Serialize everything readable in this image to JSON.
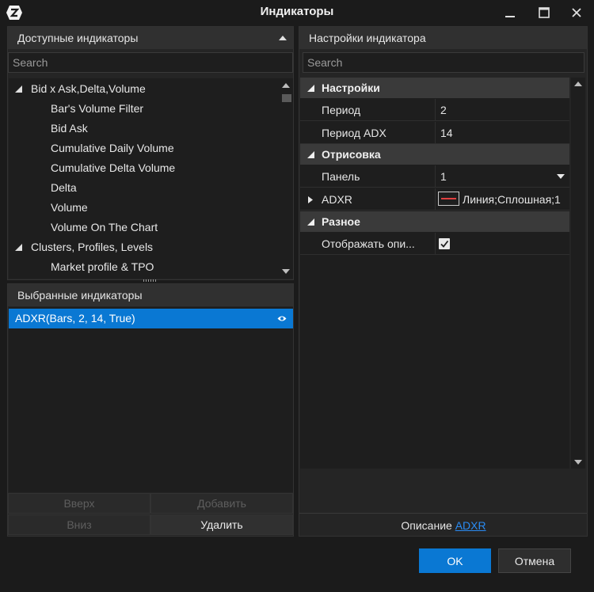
{
  "window": {
    "title": "Индикаторы",
    "icons": {
      "logo": "app-logo-icon",
      "minimize": "minimize-icon",
      "maximize": "maximize-icon",
      "close": "close-icon"
    }
  },
  "available": {
    "header": "Доступные индикаторы",
    "search_placeholder": "Search",
    "groups": [
      {
        "label": "Bid x Ask,Delta,Volume",
        "items": [
          "Bar's Volume Filter",
          "Bid Ask",
          "Cumulative Daily Volume",
          "Cumulative Delta Volume",
          "Delta",
          "Volume",
          "Volume On The Chart"
        ]
      },
      {
        "label": "Clusters, Profiles, Levels",
        "items": [
          "Market profile & TPO"
        ]
      }
    ]
  },
  "selected": {
    "header": "Выбранные индикаторы",
    "items": [
      {
        "label": "ADXR(Bars, 2, 14, True)",
        "visible": true
      }
    ],
    "buttons": {
      "up": "Вверх",
      "add": "Добавить",
      "down": "Вниз",
      "remove": "Удалить"
    }
  },
  "settings": {
    "header": "Настройки индикатора",
    "search_placeholder": "Search",
    "categories": [
      {
        "label": "Настройки",
        "props": [
          {
            "name": "Период",
            "value": "2"
          },
          {
            "name": "Период ADX",
            "value": "14"
          }
        ]
      },
      {
        "label": "Отрисовка",
        "props": [
          {
            "name": "Панель",
            "value": "1"
          },
          {
            "name": "ADXR",
            "value": "Линия;Сплошная;1"
          }
        ]
      },
      {
        "label": "Разное",
        "props": [
          {
            "name": "Отображать опи...",
            "checked": true
          }
        ]
      }
    ],
    "line_color": "#e04040"
  },
  "description": {
    "prefix": "Описание",
    "link": "ADXR"
  },
  "dialog_buttons": {
    "ok": "OK",
    "cancel": "Отмена"
  },
  "colors": {
    "accent": "#0a78d3",
    "background": "#1b1b1b",
    "link": "#2a8bf2"
  }
}
